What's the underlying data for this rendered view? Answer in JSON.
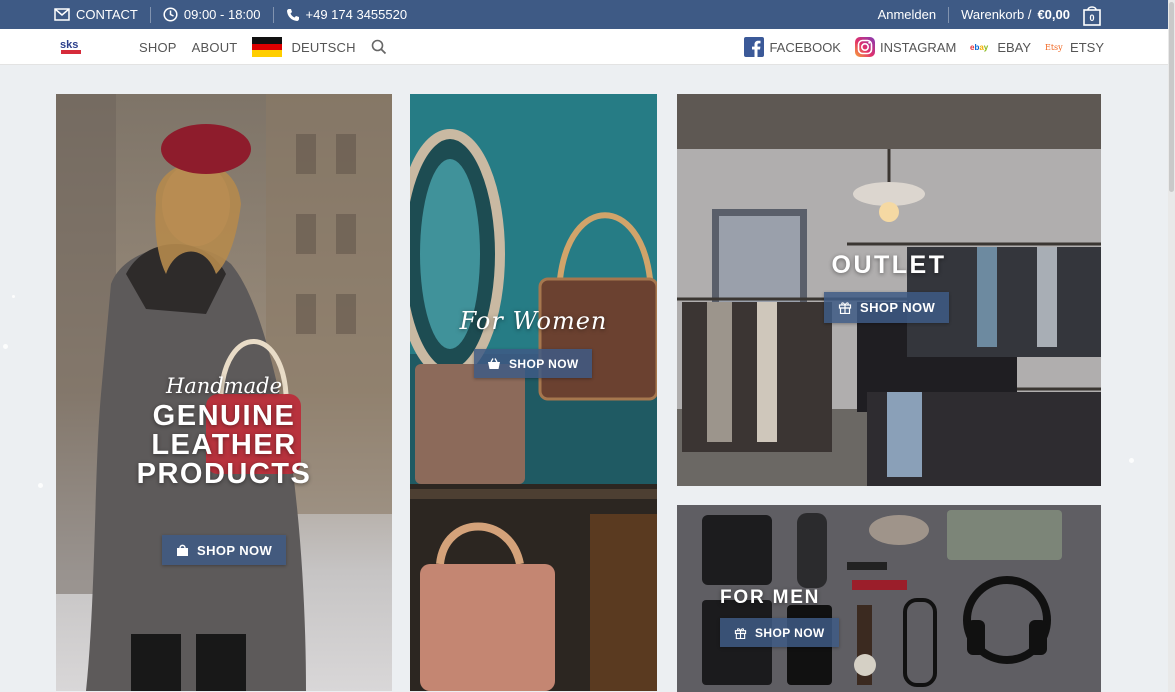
{
  "topbar": {
    "contact": "CONTACT",
    "hours": "09:00 - 18:00",
    "phone": "+49 174 3455520",
    "login": "Anmelden",
    "cart_label": "Warenkorb /",
    "cart_amount": "€0,00",
    "cart_count": "0"
  },
  "nav": {
    "logo": "sks",
    "shop": "SHOP",
    "about": "ABOUT",
    "language": "DEUTSCH",
    "facebook": "FACEBOOK",
    "instagram": "INSTAGRAM",
    "ebay": "EBAY",
    "etsy": "ETSY"
  },
  "banners": {
    "leather": {
      "script": "Handmade",
      "line1": "GENUINE",
      "line2": "LEATHER",
      "line3": "PRODUCTS",
      "button": "SHOP NOW"
    },
    "women": {
      "script": "For Women",
      "button": "SHOP NOW"
    },
    "outlet": {
      "heading": "OUTLET",
      "button": "SHOP NOW"
    },
    "men": {
      "heading": "FOR MEN",
      "button": "SHOP NOW"
    }
  },
  "colors": {
    "brand_blue": "#3e5a85",
    "background": "#eceff2"
  }
}
